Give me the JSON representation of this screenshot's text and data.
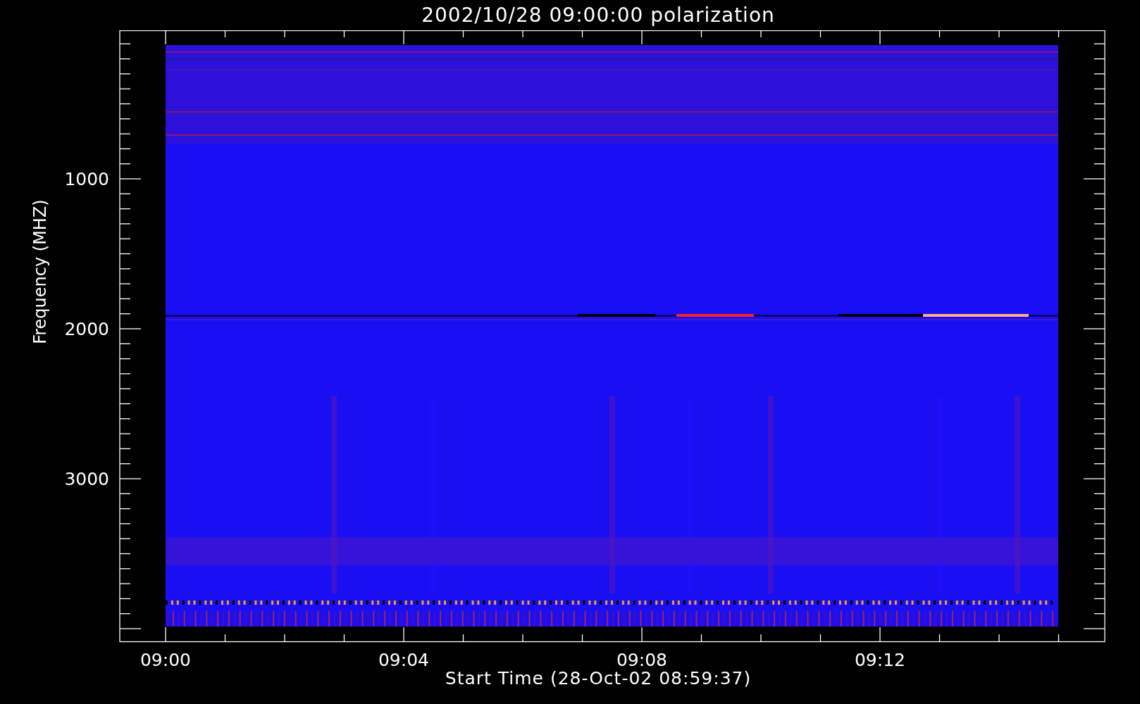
{
  "title": "2002/10/28 09:00:00 polarization",
  "y_axis": {
    "label": "Frequency (MHZ)",
    "ticks": [
      "1000",
      "2000",
      "3000"
    ]
  },
  "x_axis": {
    "label": "Start Time (28-Oct-02 08:59:37)",
    "ticks": [
      "09:00",
      "09:04",
      "09:08",
      "09:12"
    ]
  }
}
